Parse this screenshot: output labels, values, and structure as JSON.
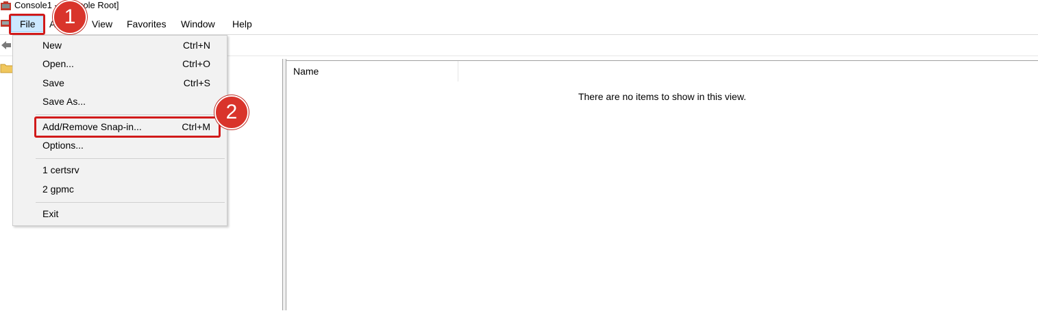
{
  "window": {
    "title": "Console1 - [Console Root]",
    "icon": "mmc-console-icon"
  },
  "menubar": {
    "items": [
      {
        "label": "File"
      },
      {
        "label": "Action"
      },
      {
        "label": "View"
      },
      {
        "label": "Favorites"
      },
      {
        "label": "Window"
      },
      {
        "label": "Help"
      }
    ]
  },
  "file_menu": {
    "items": [
      {
        "label": "New",
        "shortcut": "Ctrl+N"
      },
      {
        "label": "Open...",
        "shortcut": "Ctrl+O"
      },
      {
        "label": "Save",
        "shortcut": "Ctrl+S"
      },
      {
        "label": "Save As...",
        "shortcut": ""
      },
      {
        "label": "Add/Remove Snap-in...",
        "shortcut": "Ctrl+M"
      },
      {
        "label": "Options...",
        "shortcut": ""
      },
      {
        "label": "1 certsrv",
        "shortcut": ""
      },
      {
        "label": "2 gpmc",
        "shortcut": ""
      },
      {
        "label": "Exit",
        "shortcut": ""
      }
    ]
  },
  "content": {
    "column_name": "Name",
    "empty_message": "There are no items to show in this view."
  },
  "annotations": {
    "step1": "1",
    "step2": "2"
  },
  "colors": {
    "highlight_red": "#d11a1a",
    "badge_red": "#d9342b",
    "menu_selected": "#cce8ff",
    "menu_bg": "#f2f2f2"
  }
}
